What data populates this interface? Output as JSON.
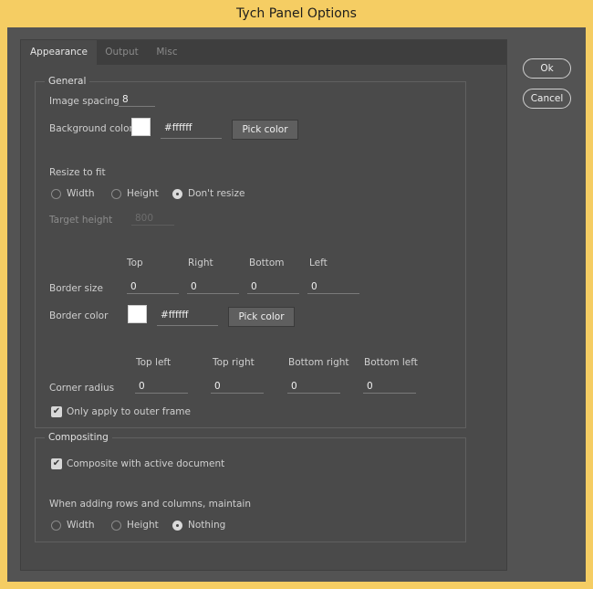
{
  "window": {
    "title": "Tych Panel Options"
  },
  "tabs": [
    "Appearance",
    "Output",
    "Misc"
  ],
  "general": {
    "title": "General",
    "image_spacing_label": "Image spacing",
    "image_spacing_value": "8",
    "background_color_label": "Background color",
    "background_color_hex": "#ffffff",
    "pick_color": "Pick color",
    "resize_to_fit_label": "Resize to fit",
    "resize_options": [
      "Width",
      "Height",
      "Don't resize"
    ],
    "resize_selected": "Don't resize",
    "target_height_label": "Target height",
    "target_height_value": "800",
    "border_headers": [
      "Top",
      "Right",
      "Bottom",
      "Left"
    ],
    "border_size_label": "Border size",
    "border_values": [
      "0",
      "0",
      "0",
      "0"
    ],
    "border_color_label": "Border color",
    "border_color_hex": "#ffffff",
    "corner_headers": [
      "Top left",
      "Top right",
      "Bottom right",
      "Bottom left"
    ],
    "corner_radius_label": "Corner radius",
    "corner_values": [
      "0",
      "0",
      "0",
      "0"
    ],
    "outer_frame_label": "Only apply to outer frame",
    "outer_frame_checked": true
  },
  "compositing": {
    "title": "Compositing",
    "composite_label": "Composite with active document",
    "composite_checked": true,
    "maintain_label": "When adding rows and columns, maintain",
    "maintain_options": [
      "Width",
      "Height",
      "Nothing"
    ],
    "maintain_selected": "Nothing"
  },
  "buttons": {
    "ok": "Ok",
    "cancel": "Cancel"
  },
  "colors": {
    "title_bar": "#f5cd63",
    "panel_bg": "#535353",
    "content_bg": "#4a4a4a",
    "swatch": "#ffffff"
  }
}
